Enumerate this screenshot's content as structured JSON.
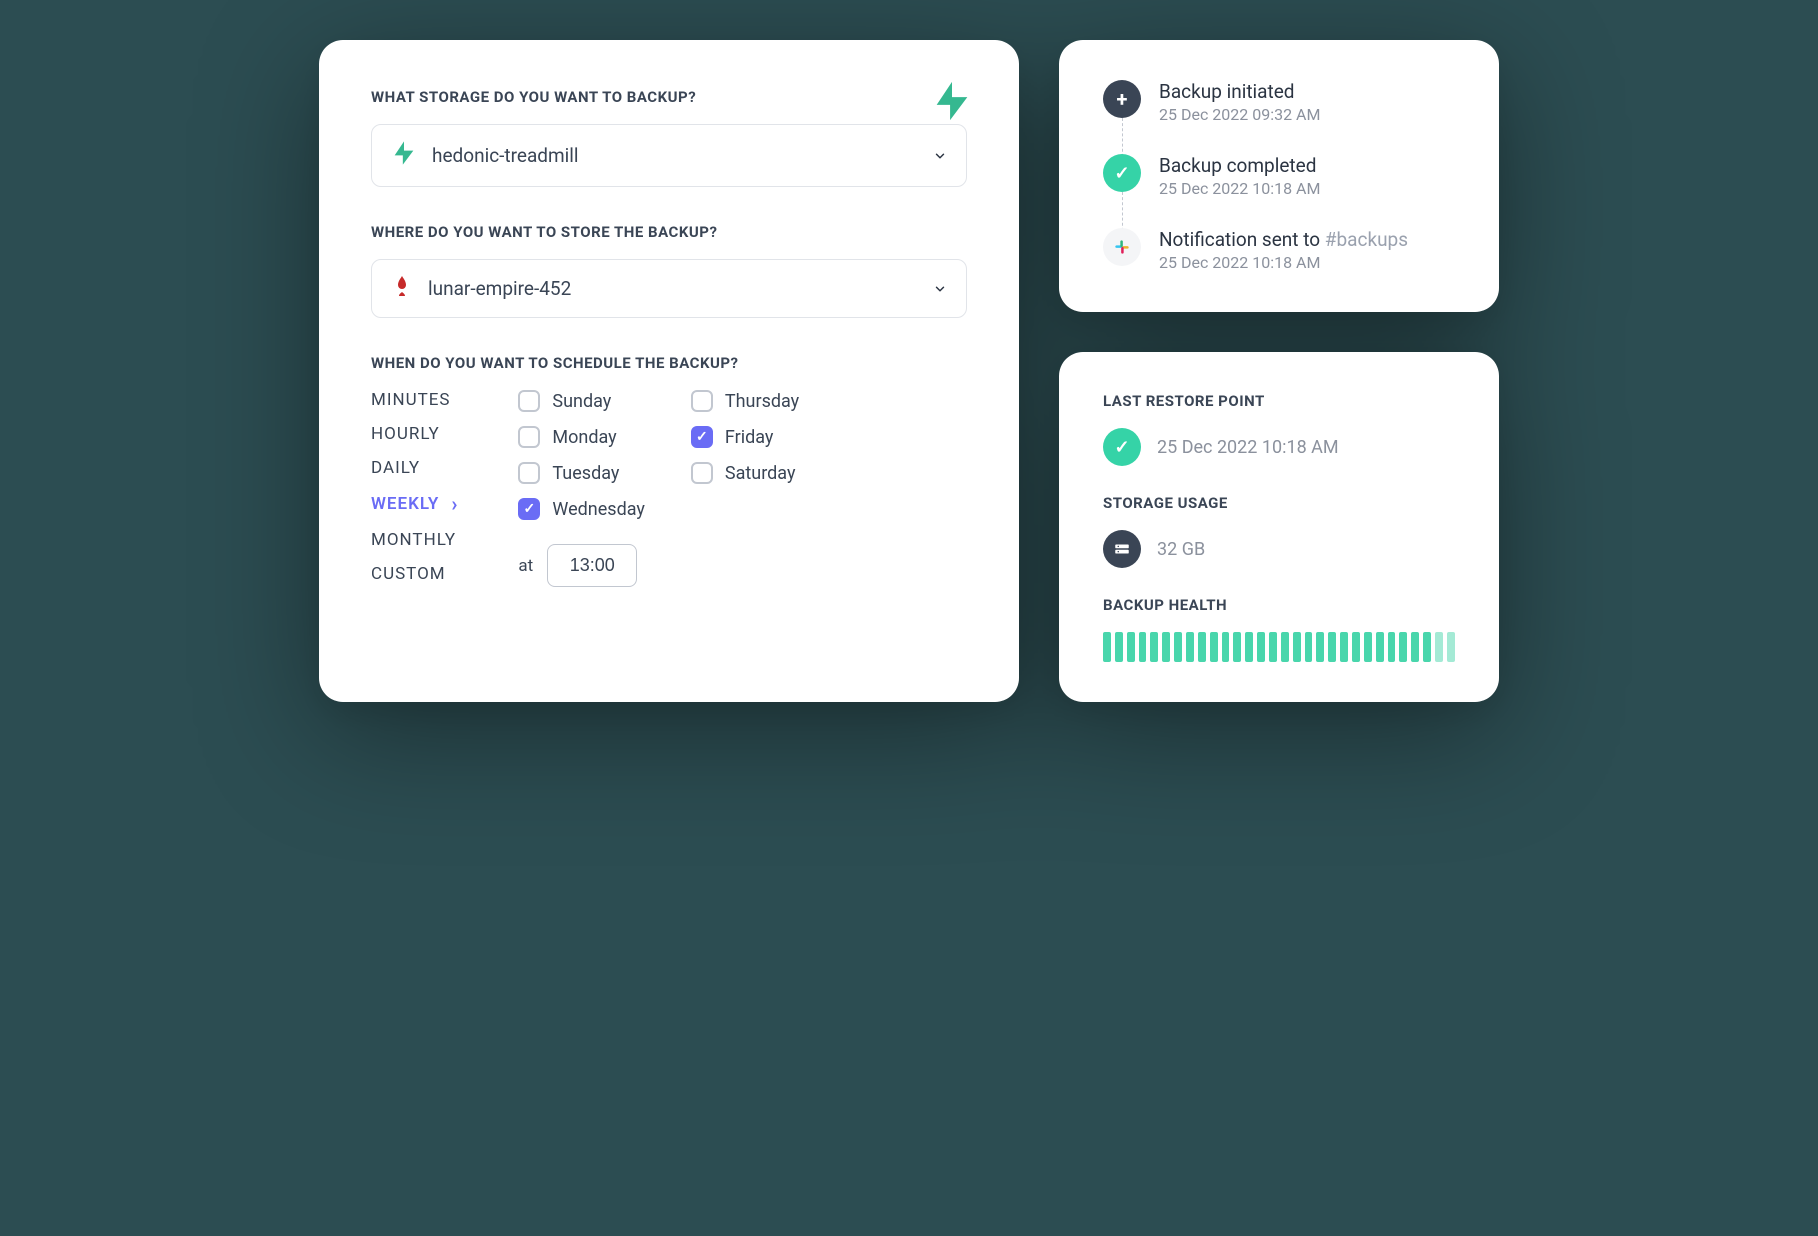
{
  "config": {
    "q_storage": "WHAT STORAGE DO YOU WANT TO BACKUP?",
    "storage_value": "hedonic-treadmill",
    "q_destination": "WHERE DO YOU WANT TO STORE THE BACKUP?",
    "destination_value": "lunar-empire-452",
    "q_schedule": "WHEN DO YOU WANT TO SCHEDULE THE BACKUP?",
    "frequencies": {
      "minutes": "MINUTES",
      "hourly": "HOURLY",
      "daily": "DAILY",
      "weekly": "WEEKLY",
      "monthly": "MONTHLY",
      "custom": "CUSTOM"
    },
    "days": {
      "sunday": "Sunday",
      "monday": "Monday",
      "tuesday": "Tuesday",
      "wednesday": "Wednesday",
      "thursday": "Thursday",
      "friday": "Friday",
      "saturday": "Saturday"
    },
    "at_label": "at",
    "time_value": "13:00"
  },
  "timeline": {
    "initiated": {
      "title": "Backup initiated",
      "ts": "25 Dec 2022 09:32 AM"
    },
    "completed": {
      "title": "Backup completed",
      "ts": "25 Dec 2022 10:18 AM"
    },
    "notified": {
      "title_prefix": "Notification sent to ",
      "channel": "#backups",
      "ts": "25 Dec 2022 10:18 AM"
    }
  },
  "status": {
    "restore_label": "LAST RESTORE POINT",
    "restore_value": "25 Dec 2022 10:18 AM",
    "usage_label": "STORAGE USAGE",
    "usage_value": "32 GB",
    "health_label": "BACKUP HEALTH"
  }
}
